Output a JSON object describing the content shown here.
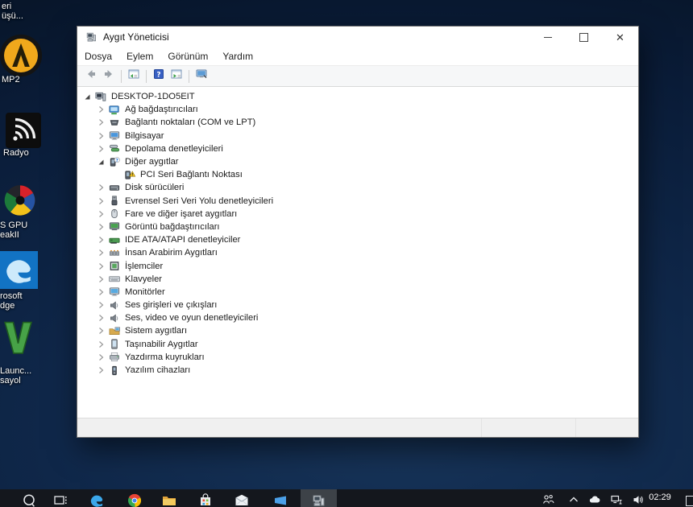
{
  "desktop_icons": [
    {
      "name": "recycle-bin",
      "label_lines": [
        "eri",
        "üşü..."
      ]
    },
    {
      "name": "aimp2",
      "label_lines": [
        "MP2"
      ]
    },
    {
      "name": "radio",
      "label_lines": [
        "Radyo"
      ]
    },
    {
      "name": "gpu-tweak",
      "label_lines": [
        "S GPU",
        "eakII"
      ]
    },
    {
      "name": "microsoft-edge",
      "label_lines": [
        "rosoft",
        "dge"
      ]
    },
    {
      "name": "gtav-launcher",
      "label_lines": [
        "Launc...",
        "sayol"
      ]
    }
  ],
  "window": {
    "title": "Aygıt Yöneticisi",
    "controls": [
      {
        "name": "minimize"
      },
      {
        "name": "maximize"
      },
      {
        "name": "close"
      }
    ],
    "menu": [
      "Dosya",
      "Eylem",
      "Görünüm",
      "Yardım"
    ],
    "toolbar_groups": [
      [
        "back",
        "forward"
      ],
      [
        "console-tree"
      ],
      [
        "help",
        "properties"
      ],
      [
        "scan-hardware"
      ]
    ],
    "tree": [
      {
        "label": "DESKTOP-1DO5EIT",
        "icon": "computer",
        "state": "expanded",
        "level": 0
      },
      {
        "label": "Ağ bağdaştırıcıları",
        "icon": "network-adapter",
        "state": "collapsed",
        "level": 1
      },
      {
        "label": "Bağlantı noktaları (COM ve LPT)",
        "icon": "ports",
        "state": "collapsed",
        "level": 1
      },
      {
        "label": "Bilgisayar",
        "icon": "computer-monitor",
        "state": "collapsed",
        "level": 1
      },
      {
        "label": "Depolama denetleyicileri",
        "icon": "storage-controller",
        "state": "collapsed",
        "level": 1
      },
      {
        "label": "Diğer aygıtlar",
        "icon": "unknown-device",
        "state": "expanded",
        "level": 1
      },
      {
        "label": "PCI Seri Bağlantı Noktası",
        "icon": "warning-device",
        "state": "leaf",
        "level": 2
      },
      {
        "label": "Disk sürücüleri",
        "icon": "disk-drive",
        "state": "collapsed",
        "level": 1
      },
      {
        "label": "Evrensel Seri Veri Yolu denetleyicileri",
        "icon": "usb-controller",
        "state": "collapsed",
        "level": 1
      },
      {
        "label": "Fare ve diğer işaret aygıtları",
        "icon": "mouse",
        "state": "collapsed",
        "level": 1
      },
      {
        "label": "Görüntü bağdaştırıcıları",
        "icon": "display-adapter",
        "state": "collapsed",
        "level": 1
      },
      {
        "label": "IDE ATA/ATAPI denetleyiciler",
        "icon": "ide-controller",
        "state": "collapsed",
        "level": 1
      },
      {
        "label": "İnsan Arabirim Aygıtları",
        "icon": "hid-device",
        "state": "collapsed",
        "level": 1
      },
      {
        "label": "İşlemciler",
        "icon": "processor",
        "state": "collapsed",
        "level": 1
      },
      {
        "label": "Klavyeler",
        "icon": "keyboard",
        "state": "collapsed",
        "level": 1
      },
      {
        "label": "Monitörler",
        "icon": "monitor",
        "state": "collapsed",
        "level": 1
      },
      {
        "label": "Ses girişleri ve çıkışları",
        "icon": "audio-device",
        "state": "collapsed",
        "level": 1
      },
      {
        "label": "Ses, video ve oyun denetleyicileri",
        "icon": "audio-device",
        "state": "collapsed",
        "level": 1
      },
      {
        "label": "Sistem aygıtları",
        "icon": "system-devices",
        "state": "collapsed",
        "level": 1
      },
      {
        "label": "Taşınabilir Aygıtlar",
        "icon": "portable-device",
        "state": "collapsed",
        "level": 1
      },
      {
        "label": "Yazdırma kuyrukları",
        "icon": "printer",
        "state": "collapsed",
        "level": 1
      },
      {
        "label": "Yazılım cihazları",
        "icon": "software-device",
        "state": "collapsed",
        "level": 1
      }
    ],
    "status_panes": [
      "",
      "",
      ""
    ]
  },
  "taskbar": {
    "items": [
      "search",
      "task-view",
      "edge",
      "chrome",
      "file-explorer",
      "store",
      "mail",
      "photos",
      "device-manager"
    ],
    "active_item": "device-manager",
    "tray": [
      "people",
      "chevron-up",
      "onedrive",
      "network",
      "volume"
    ],
    "clock_time": "02:29"
  },
  "colors": {
    "desktop_blue": "#0f2749",
    "taskbar_dark": "#14171d",
    "active_app_highlight": "#3d4248",
    "warning_yellow": "#f5c722",
    "help_blue": "#3860c4"
  }
}
